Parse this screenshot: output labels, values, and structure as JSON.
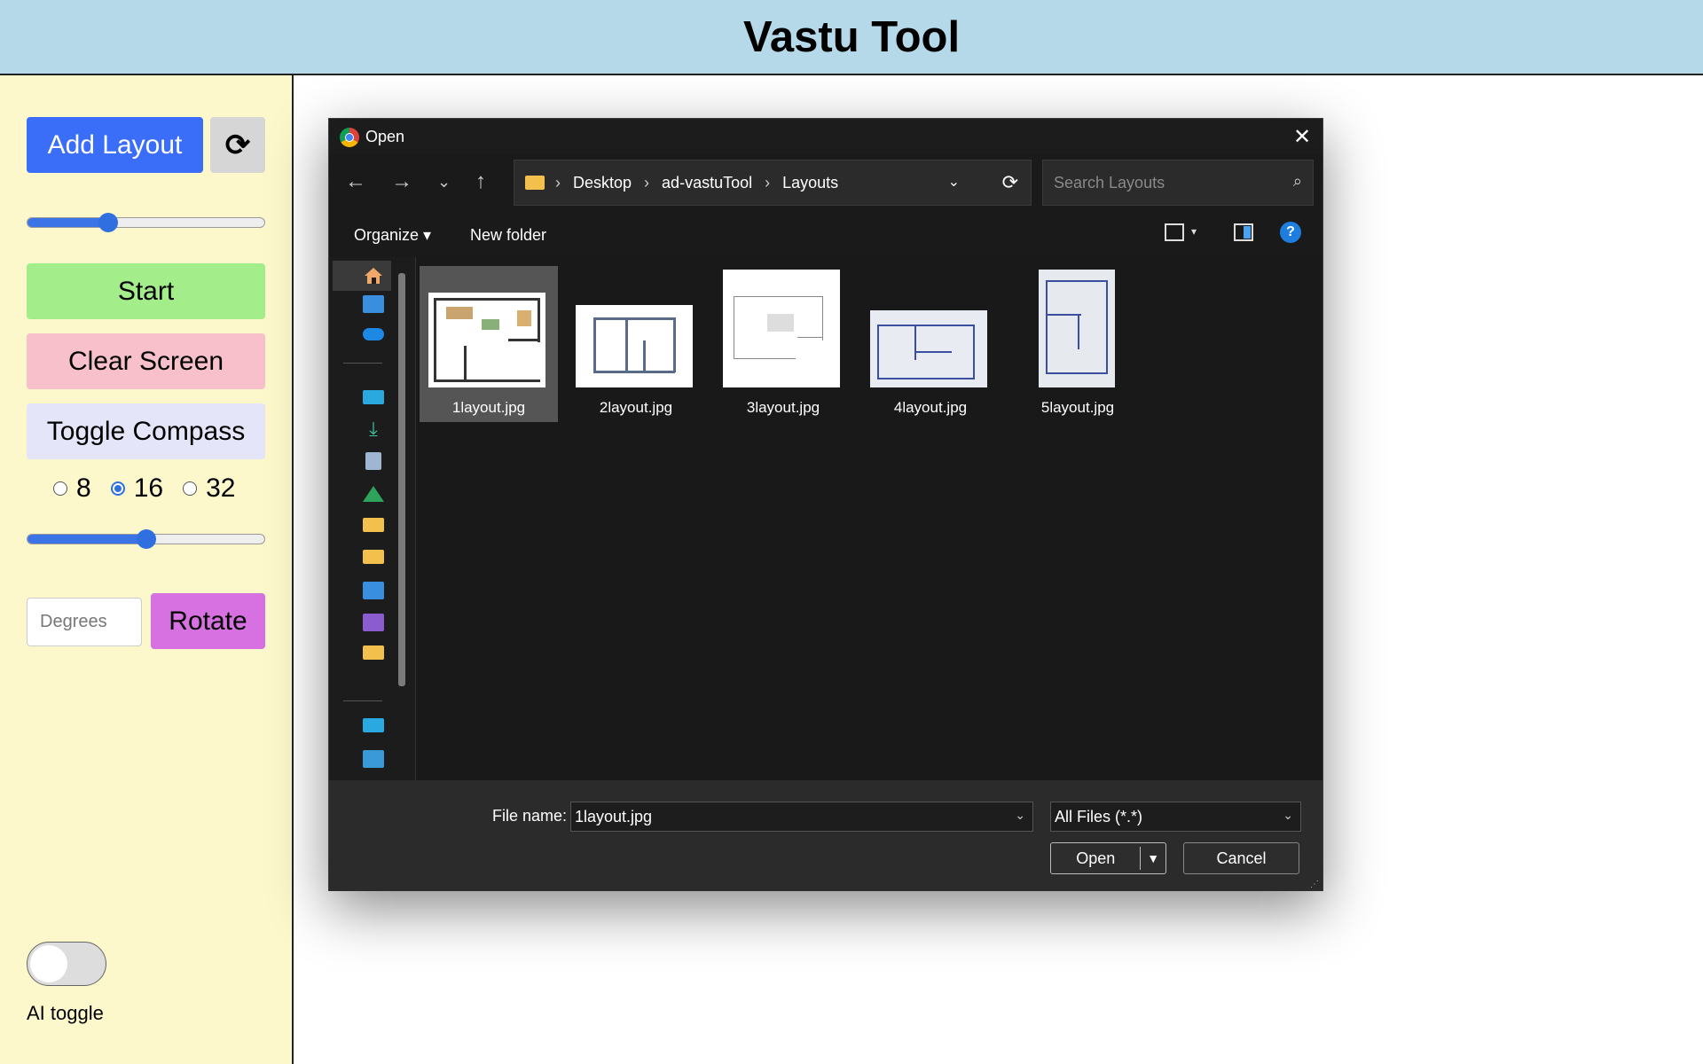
{
  "app": {
    "title": "Vastu Tool"
  },
  "sidebar": {
    "add_layout_label": "Add Layout",
    "refresh_icon": "⟳",
    "scale_slider_value": 0.34,
    "start_label": "Start",
    "clear_label": "Clear Screen",
    "compass_label": "Toggle Compass",
    "compass_options": [
      "8",
      "16",
      "32"
    ],
    "compass_selected": "16",
    "opacity_slider_value": 0.5,
    "degrees_placeholder": "Degrees",
    "rotate_label": "Rotate",
    "ai_toggle_label": "AI toggle",
    "ai_toggle_on": false
  },
  "dialog": {
    "title": "Open",
    "close_icon": "✕",
    "nav": {
      "back": "←",
      "forward": "→",
      "history": "⌄",
      "up": "↑"
    },
    "breadcrumb": [
      "Desktop",
      "ad-vastuTool",
      "Layouts"
    ],
    "breadcrumb_sep": "›",
    "search_placeholder": "Search Layouts",
    "search_icon": "⌕",
    "organize_label": "Organize ▾",
    "new_folder_label": "New folder",
    "help_label": "?",
    "files": [
      {
        "name": "1layout.jpg",
        "selected": true
      },
      {
        "name": "2layout.jpg",
        "selected": false
      },
      {
        "name": "3layout.jpg",
        "selected": false
      },
      {
        "name": "4layout.jpg",
        "selected": false
      },
      {
        "name": "5layout.jpg",
        "selected": false
      }
    ],
    "file_name_label": "File name:",
    "file_name_value": "1layout.jpg",
    "file_type_value": "All Files (*.*)",
    "open_label": "Open",
    "cancel_label": "Cancel"
  }
}
